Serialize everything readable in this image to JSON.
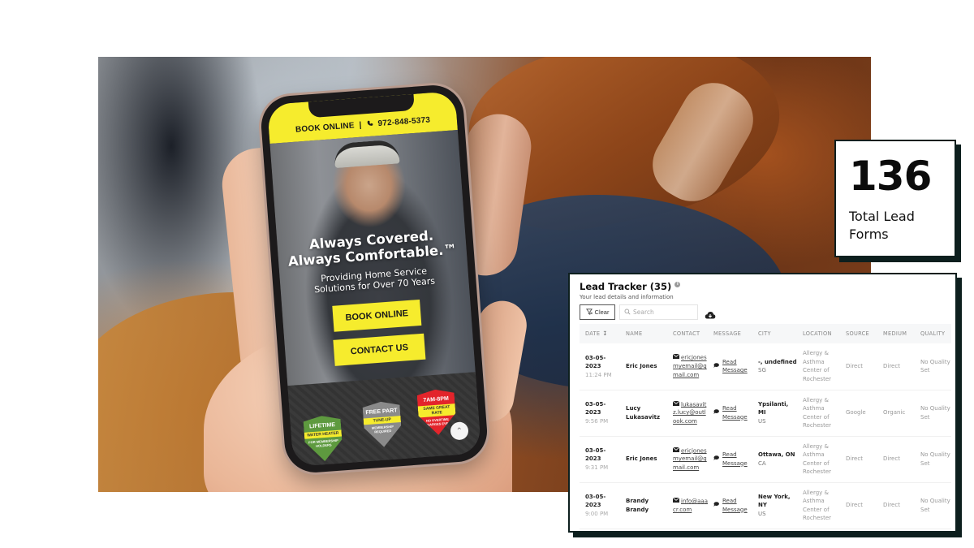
{
  "phone_site": {
    "top_bar": {
      "book_label": "BOOK ONLINE",
      "separator": "|",
      "phone_icon": "phone-icon",
      "phone_number": "972-848-5373"
    },
    "hero": {
      "title_line1": "Always Covered.",
      "title_line2": "Always Comfortable.™",
      "subtitle_line1": "Providing Home Service",
      "subtitle_line2": "Solutions for Over 70 Years"
    },
    "buttons": {
      "book_online": "BOOK ONLINE",
      "contact_us": "CONTACT US"
    },
    "badges": [
      {
        "title": "LIFETIME",
        "ribbon": "WATER HEATER",
        "small": "FOR MEMBERSHIP HOLDERS",
        "color": "#5e9a3f"
      },
      {
        "title": "FREE PART",
        "ribbon": "TUNE-UP",
        "small": "MEMBERSHIP REQUIRED",
        "color": "#8a8a8a"
      },
      {
        "title": "7AM-8PM",
        "ribbon": "SAME GREAT RATE",
        "small": "NO OVERTIME CHARGES EVER",
        "color": "#e3242b"
      }
    ],
    "scroll_top_icon": "chevron-up-icon",
    "accent_color": "#f6ec2d"
  },
  "stat_card": {
    "value": "136",
    "label_line1": "Total Lead",
    "label_line2": "Forms"
  },
  "lead_tracker": {
    "title": "Lead Tracker (35)",
    "subtitle": "Your lead details and information",
    "clear_label": "Clear",
    "search_placeholder": "Search",
    "columns": [
      "DATE",
      "NAME",
      "CONTACT",
      "MESSAGE",
      "CITY",
      "LOCATION",
      "SOURCE",
      "MEDIUM",
      "QUALITY"
    ],
    "rows": [
      {
        "date": "03-05-2023",
        "time": "11:24 PM",
        "name": "Eric Jones",
        "contact": "ericjonesmyemail@gmail.com",
        "message": "Read Message",
        "city": "-, undefined",
        "country": "SG",
        "location": "Allergy & Asthma Center of Rochester",
        "source": "Direct",
        "medium": "Direct",
        "quality": "No Quality Set"
      },
      {
        "date": "03-05-2023",
        "time": "9:56 PM",
        "name": "Lucy Lukasavitz",
        "contact": "lukasavitz.lucy@outlook.com",
        "message": "Read Message",
        "city": "Ypsilanti, MI",
        "country": "US",
        "location": "Allergy & Asthma Center of Rochester",
        "source": "Google",
        "medium": "Organic",
        "quality": "No Quality Set"
      },
      {
        "date": "03-05-2023",
        "time": "9:31 PM",
        "name": "Eric Jones",
        "contact": "ericjonesmyemail@gmail.com",
        "message": "Read Message",
        "city": "Ottawa, ON",
        "country": "CA",
        "location": "Allergy & Asthma Center of Rochester",
        "source": "Direct",
        "medium": "Direct",
        "quality": "No Quality Set"
      },
      {
        "date": "03-05-2023",
        "time": "9:00 PM",
        "name": "Brandy Brandy",
        "contact": "info@aaacr.com",
        "message": "Read Message",
        "city": "New York, NY",
        "country": "US",
        "location": "Allergy & Asthma Center of Rochester",
        "source": "Direct",
        "medium": "Direct",
        "quality": "No Quality Set"
      }
    ]
  },
  "colors": {
    "panel_border": "#0d1f1e",
    "brand_yellow": "#f6ec2d"
  }
}
